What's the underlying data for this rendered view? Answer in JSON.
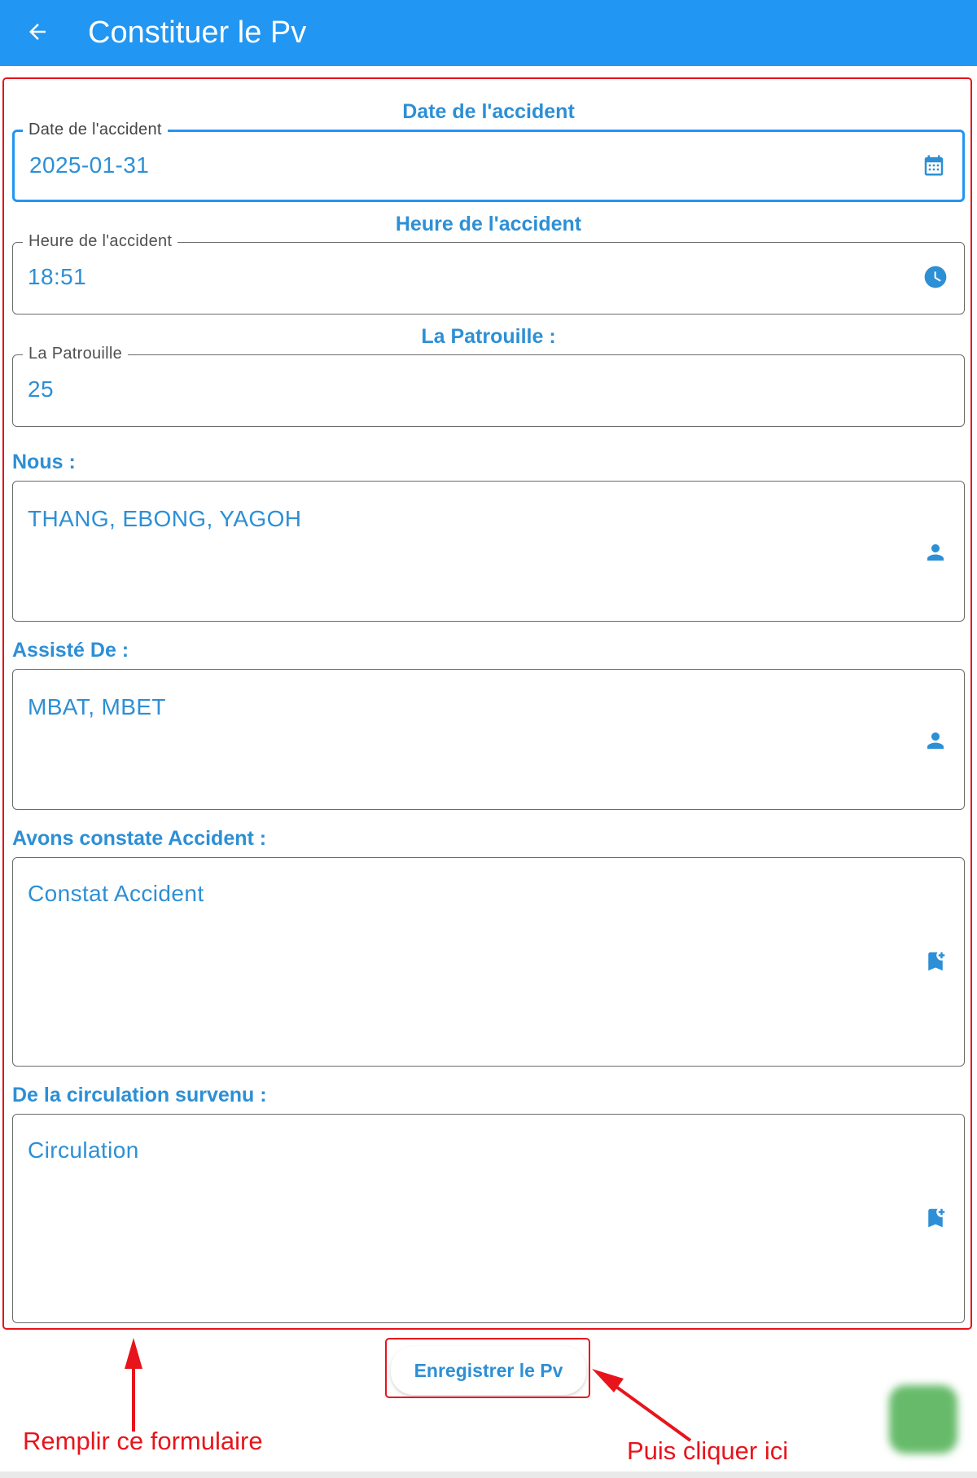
{
  "appbar": {
    "title": "Constituer le Pv",
    "background_color": "#2196f3",
    "back_icon": "arrow-back-icon"
  },
  "form": {
    "date_section": {
      "heading": "Date de l'accident",
      "field_label": "Date de l'accident",
      "value": "2025-01-31",
      "icon": "calendar-icon"
    },
    "time_section": {
      "heading": "Heure de l'accident",
      "field_label": "Heure de l'accident",
      "value": "18:51",
      "icon": "clock-icon"
    },
    "patrol_section": {
      "heading": "La Patrouille :",
      "field_label": "La Patrouille",
      "value": "25"
    },
    "nous_section": {
      "heading": "Nous :",
      "value": "THANG, EBONG, YAGOH",
      "icon": "person-icon"
    },
    "assiste_section": {
      "heading": "Assisté De :",
      "value": "MBAT, MBET",
      "icon": "person-icon"
    },
    "constat_section": {
      "heading": "Avons constate Accident :",
      "value": "Constat Accident",
      "icon": "bookmark-add-icon"
    },
    "circulation_section": {
      "heading": "De la circulation survenu :",
      "value": "Circulation",
      "icon": "bookmark-add-icon"
    }
  },
  "submit_button": {
    "label": "Enregistrer le Pv"
  },
  "annotations": {
    "fill_form": "Remplir ce formulaire",
    "then_click": "Puis cliquer ici",
    "color": "#e8141b"
  },
  "colors": {
    "accent": "#2d8fd5",
    "primary": "#2196f3"
  }
}
